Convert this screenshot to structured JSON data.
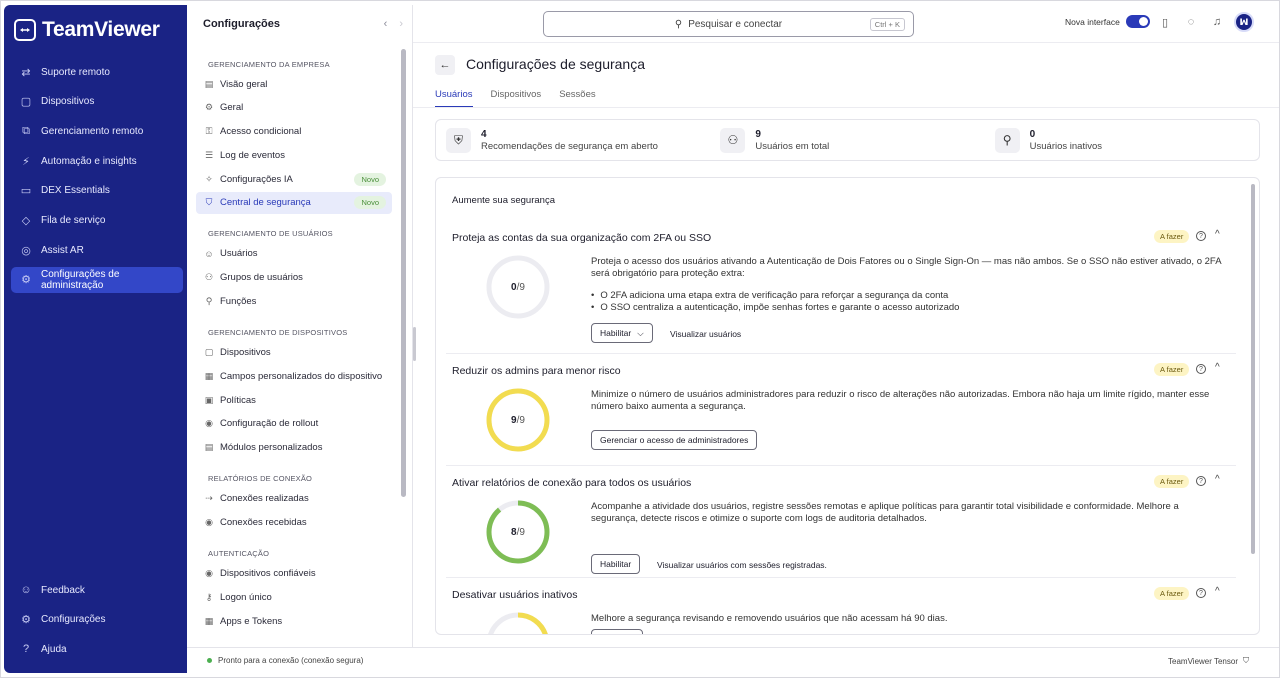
{
  "app": {
    "name": "TeamViewer"
  },
  "leftnav": {
    "items": [
      {
        "label": "Suporte remoto",
        "icon": "⇄"
      },
      {
        "label": "Dispositivos",
        "icon": "▢"
      },
      {
        "label": "Gerenciamento remoto",
        "icon": "⧉"
      },
      {
        "label": "Automação e insights",
        "icon": "⚡"
      },
      {
        "label": "DEX Essentials",
        "icon": "▭"
      },
      {
        "label": "Fila de serviço",
        "icon": "◇"
      },
      {
        "label": "Assist AR",
        "icon": "◎"
      },
      {
        "label": "Configurações de administração",
        "icon": "⚙"
      }
    ],
    "bottom": [
      {
        "label": "Feedback",
        "icon": "☺"
      },
      {
        "label": "Configurações",
        "icon": "⚙"
      },
      {
        "label": "Ajuda",
        "icon": "?"
      }
    ]
  },
  "subside": {
    "title": "Configurações",
    "groups": [
      {
        "title": "GERENCIAMENTO DA EMPRESA",
        "items": [
          {
            "label": "Visão geral",
            "icon": "▤"
          },
          {
            "label": "Geral",
            "icon": "⚙"
          },
          {
            "label": "Acesso condicional",
            "icon": "⚿"
          },
          {
            "label": "Log de eventos",
            "icon": "☰"
          },
          {
            "label": "Configurações IA",
            "icon": "✧",
            "badge": "Novo"
          },
          {
            "label": "Central de segurança",
            "icon": "⛉",
            "badge": "Novo",
            "active": true
          }
        ]
      },
      {
        "title": "GERENCIAMENTO DE USUÁRIOS",
        "items": [
          {
            "label": "Usuários",
            "icon": "☺"
          },
          {
            "label": "Grupos de usuários",
            "icon": "⚇"
          },
          {
            "label": "Funções",
            "icon": "⚲"
          }
        ]
      },
      {
        "title": "GERENCIAMENTO DE DISPOSITIVOS",
        "items": [
          {
            "label": "Dispositivos",
            "icon": "▢"
          },
          {
            "label": "Campos personalizados do dispositivo",
            "icon": "▦"
          },
          {
            "label": "Políticas",
            "icon": "▣"
          },
          {
            "label": "Configuração de rollout",
            "icon": "◉"
          },
          {
            "label": "Módulos personalizados",
            "icon": "▤"
          }
        ]
      },
      {
        "title": "RELATÓRIOS DE CONEXÃO",
        "items": [
          {
            "label": "Conexões realizadas",
            "icon": "⇢"
          },
          {
            "label": "Conexões recebidas",
            "icon": "◉"
          }
        ]
      },
      {
        "title": "AUTENTICAÇÃO",
        "items": [
          {
            "label": "Dispositivos confiáveis",
            "icon": "◉"
          },
          {
            "label": "Logon único",
            "icon": "⚷"
          },
          {
            "label": "Apps e Tokens",
            "icon": "▦"
          }
        ]
      }
    ]
  },
  "topbar": {
    "search_label": "Pesquisar e conectar",
    "search_shortcut": "Ctrl + K",
    "new_ui_label": "Nova interface",
    "avatar_initials": "ꟽ"
  },
  "main": {
    "title": "Configurações de segurança",
    "tabs": [
      {
        "label": "Usuários",
        "active": true
      },
      {
        "label": "Dispositivos"
      },
      {
        "label": "Sessões"
      }
    ],
    "stats": [
      {
        "value": "4",
        "label": "Recomendações de segurança em aberto",
        "icon": "⛨"
      },
      {
        "value": "9",
        "label": "Usuários em total",
        "icon": "⚇"
      },
      {
        "value": "0",
        "label": "Usuários inativos",
        "icon": "⚲"
      }
    ],
    "card_title": "Aumente sua segurança",
    "sections": [
      {
        "title": "Proteja as contas da sua organização com 2FA ou SSO",
        "badge": "A fazer",
        "done": "0",
        "total": "9",
        "ratio": 0.0,
        "ring_color": "#e5e5ec",
        "desc": "Proteja o acesso dos usuários ativando a Autenticação de Dois Fatores ou o Single Sign-On — mas não ambos. Se o SSO não estiver ativado, o 2FA será obrigatório para proteção extra:",
        "bullets": [
          "O 2FA adiciona uma etapa extra de verificação para reforçar a segurança da conta",
          "O SSO centraliza a autenticação, impõe senhas fortes e garante o acesso autorizado"
        ],
        "button": "Habilitar",
        "link": "Visualizar usuários"
      },
      {
        "title": "Reduzir os admins para menor risco",
        "badge": "A fazer",
        "done": "9",
        "total": "9",
        "ratio": 1.0,
        "ring_color": "#f2dc50",
        "desc": "Minimize o número de usuários administradores para reduzir o risco de alterações não autorizadas. Embora não haja um limite rígido, manter esse número baixo aumenta a segurança.",
        "button": "Gerenciar o acesso de administradores"
      },
      {
        "title": "Ativar relatórios de conexão para todos os usuários",
        "badge": "A fazer",
        "done": "8",
        "total": "9",
        "ratio": 0.889,
        "ring_color": "#7ebd55",
        "desc": "Acompanhe a atividade dos usuários, registre sessões remotas e aplique políticas para garantir total visibilidade e conformidade. Melhore a segurança, detecte riscos e otimize o suporte com logs de auditoria detalhados.",
        "button": "Habilitar",
        "link": "Visualizar usuários com sessões registradas."
      },
      {
        "title": "Desativar usuários inativos",
        "badge": "A fazer",
        "done": "",
        "total": "",
        "ratio": 0.2,
        "ring_color": "#f2dc50",
        "desc": "Melhore a segurança revisando e removendo usuários que não acessam há 90 dias."
      }
    ]
  },
  "statusbar": {
    "connection": "Pronto para a conexão (conexão segura)",
    "product": "TeamViewer Tensor"
  },
  "colors": {
    "nav_bg": "#1a2385",
    "accent": "#2a3ab8",
    "badge_todo": "#fdf4c4"
  }
}
